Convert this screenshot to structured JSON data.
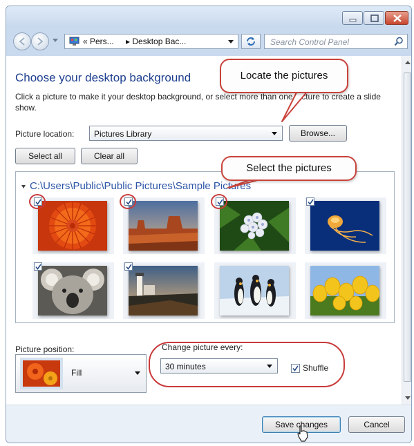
{
  "window": {
    "address_crumbs": [
      "« Pers...",
      "▸ Desktop Bac..."
    ],
    "search_placeholder": "Search Control Panel"
  },
  "main": {
    "heading": "Choose your desktop background",
    "description": "Click a picture to make it your desktop background, or select more than one picture to create a slide show.",
    "picture_location_label": "Picture location:",
    "picture_location_value": "Pictures Library",
    "browse_label": "Browse...",
    "select_all_label": "Select all",
    "clear_all_label": "Clear all",
    "folder_path": "C:\\Users\\Public\\Public Pictures\\Sample Pictures",
    "thumbnails": [
      {
        "name": "Chrysanthemum",
        "checked": true
      },
      {
        "name": "Desert",
        "checked": true
      },
      {
        "name": "Hydrangeas",
        "checked": true
      },
      {
        "name": "Jellyfish",
        "checked": true
      },
      {
        "name": "Koala",
        "checked": true
      },
      {
        "name": "Lighthouse",
        "checked": true
      },
      {
        "name": "Penguins",
        "checked": false
      },
      {
        "name": "Tulips",
        "checked": false
      }
    ],
    "picture_position_label": "Picture position:",
    "picture_position_value": "Fill",
    "change_every_label": "Change picture every:",
    "change_every_value": "30 minutes",
    "shuffle_label": "Shuffle",
    "shuffle_checked": true
  },
  "footer": {
    "save_label": "Save changes",
    "cancel_label": "Cancel"
  },
  "annotations": {
    "callout_locate": "Locate the pictures",
    "callout_select": "Select the pictures"
  },
  "colors": {
    "heading": "#1e3f8f",
    "annotation_red": "#c93a3a",
    "window_frame": "#c9daee"
  }
}
